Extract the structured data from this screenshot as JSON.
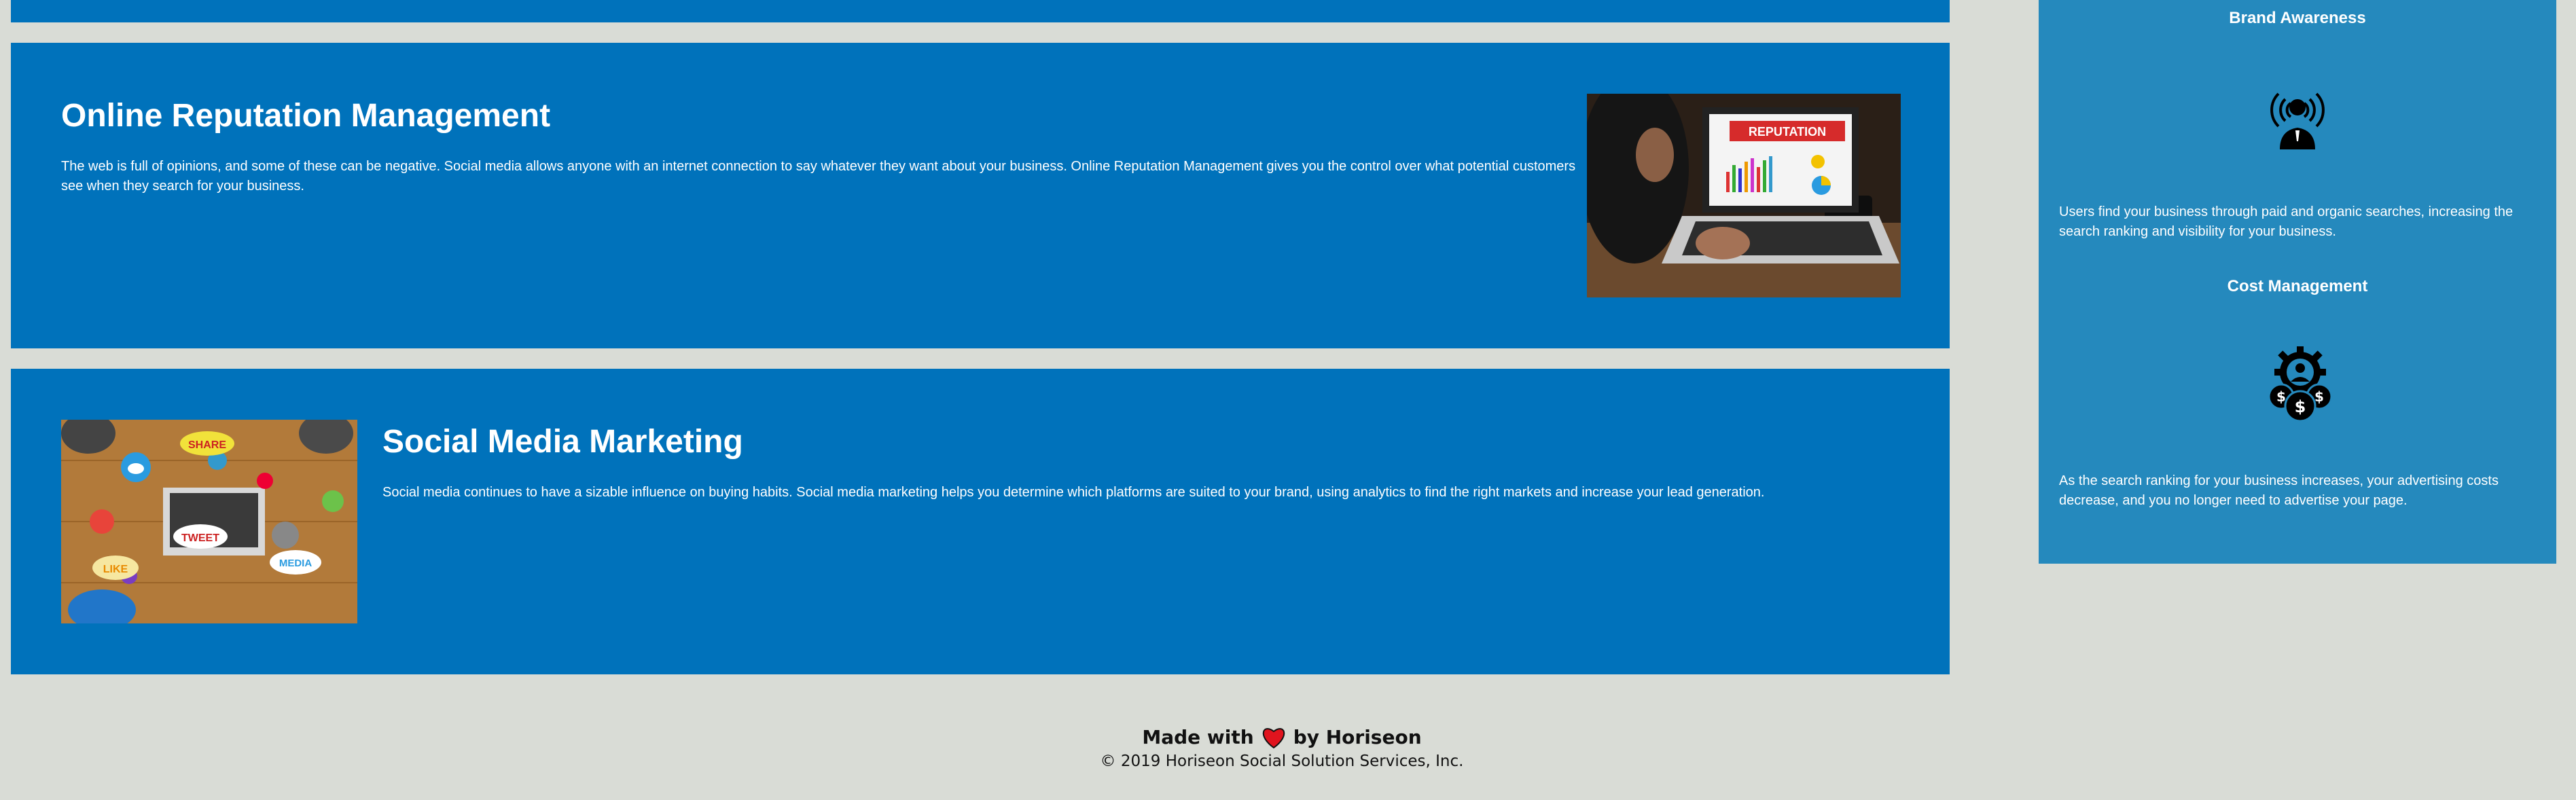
{
  "sections": {
    "online_reputation": {
      "title": "Online Reputation Management",
      "text": "The web is full of opinions, and some of these can be negative. Social media allows anyone with an internet connection to say whatever they want about your business. Online Reputation Management gives you the control over what potential customers see when they search for your business.",
      "image_sign": "REPUTATION"
    },
    "social_media": {
      "title": "Social Media Marketing",
      "text": "Social media continues to have a sizable influence on buying habits. Social media marketing helps you determine which platforms are suited to your brand, using analytics to find the right markets and increase your lead generation.",
      "image_bubbles": [
        "SHARE",
        "TWEET",
        "LIKE",
        "MEDIA"
      ]
    }
  },
  "sidebar": {
    "brand_awareness": {
      "title": "Brand Awareness",
      "icon": "broadcast-person-icon",
      "text": "Users find your business through paid and organic searches, increasing the search ranking and visibility for your business."
    },
    "cost_management": {
      "title": "Cost Management",
      "icon": "gear-coins-icon",
      "text": "As the search ranking for your business increases, your advertising costs decrease, and you no longer need to advertise your page."
    }
  },
  "footer": {
    "made_with": "Made with",
    "by": "by Horiseon",
    "copyright": "© 2019 Horiseon Social Solution Services, Inc."
  },
  "colors": {
    "section_bg": "#0072bb",
    "sidebar_bg": "#2589bd",
    "page_bg": "#d9dcd6",
    "heart": "#e0141e"
  }
}
